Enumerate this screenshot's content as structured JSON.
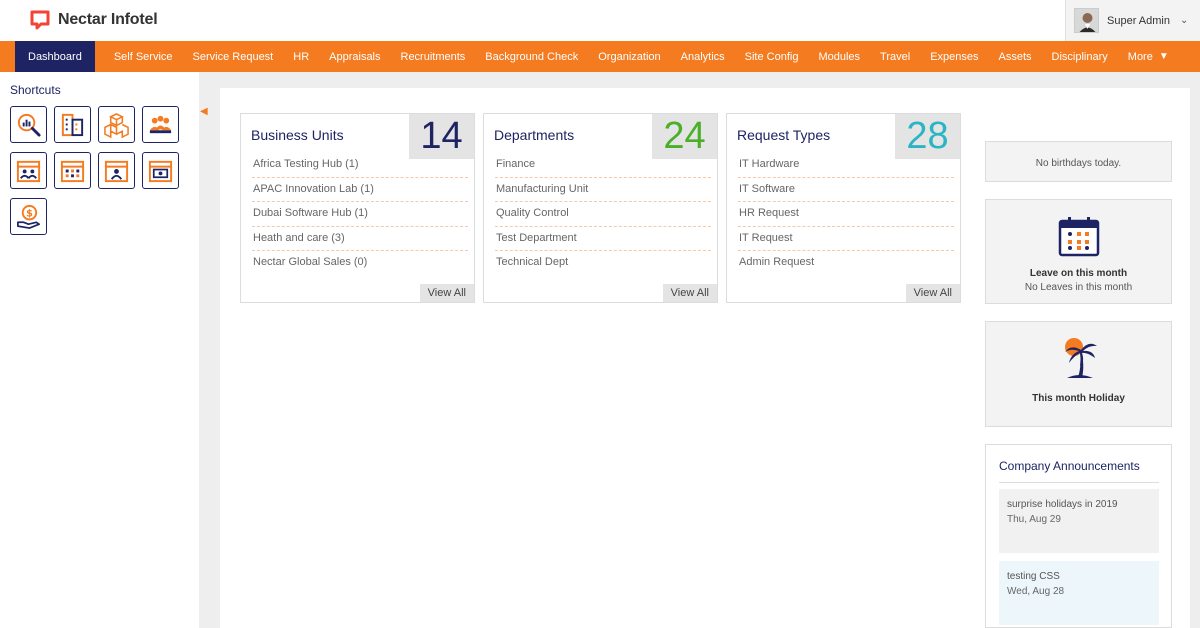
{
  "brand": {
    "name": "Nectar Infotel"
  },
  "user": {
    "name": "Super Admin",
    "caret": "⌄"
  },
  "nav": {
    "items": [
      "Dashboard",
      "Self Service",
      "Service Request",
      "HR",
      "Appraisals",
      "Recruitments",
      "Background Check",
      "Organization",
      "Analytics",
      "Site Config",
      "Modules",
      "Travel",
      "Expenses",
      "Assets",
      "Disciplinary"
    ],
    "more_label": "More",
    "more_icon": "▼",
    "active": "Dashboard"
  },
  "sidebar": {
    "title": "Shortcuts",
    "collapse_icon": "◀",
    "shortcuts": [
      "search-analytics-icon",
      "building-icon",
      "boxes-icon",
      "team-icon",
      "calendar-people-icon",
      "calendar-grid-icon",
      "calendar-person-icon",
      "calendar-money-icon",
      "money-hand-icon"
    ]
  },
  "cards": [
    {
      "title": "Business Units",
      "count": "14",
      "count_color": "#1e2463",
      "items": [
        "Africa Testing Hub (1)",
        "APAC Innovation Lab (1)",
        "Dubai Software Hub (1)",
        "Heath and care (3)",
        "Nectar Global Sales (0)"
      ],
      "view_all": "View All"
    },
    {
      "title": "Departments",
      "count": "24",
      "count_color": "#4caf2a",
      "items": [
        "Finance",
        "Manufacturing Unit",
        "Quality Control",
        "Test Department",
        "Technical Dept"
      ],
      "view_all": "View All"
    },
    {
      "title": "Request Types",
      "count": "28",
      "count_color": "#2bb5c4",
      "items": [
        "IT Hardware",
        "IT Software",
        "HR Request",
        "IT Request",
        "Admin Request"
      ],
      "view_all": "View All"
    }
  ],
  "right": {
    "birthdays": "No birthdays today.",
    "leave_title": "Leave on this month",
    "leave_sub": "No Leaves in this month",
    "holiday_title": "This month Holiday",
    "announcements_title": "Company Announcements",
    "announcements": [
      {
        "text": "surprise holidays in 2019",
        "date": "Thu, Aug 29",
        "bg": "#f1f1f1"
      },
      {
        "text": "testing CSS",
        "date": "Wed, Aug 28",
        "bg": "#ecf6fb"
      }
    ]
  },
  "colors": {
    "accent": "#f47b20",
    "navy": "#1e2463"
  }
}
